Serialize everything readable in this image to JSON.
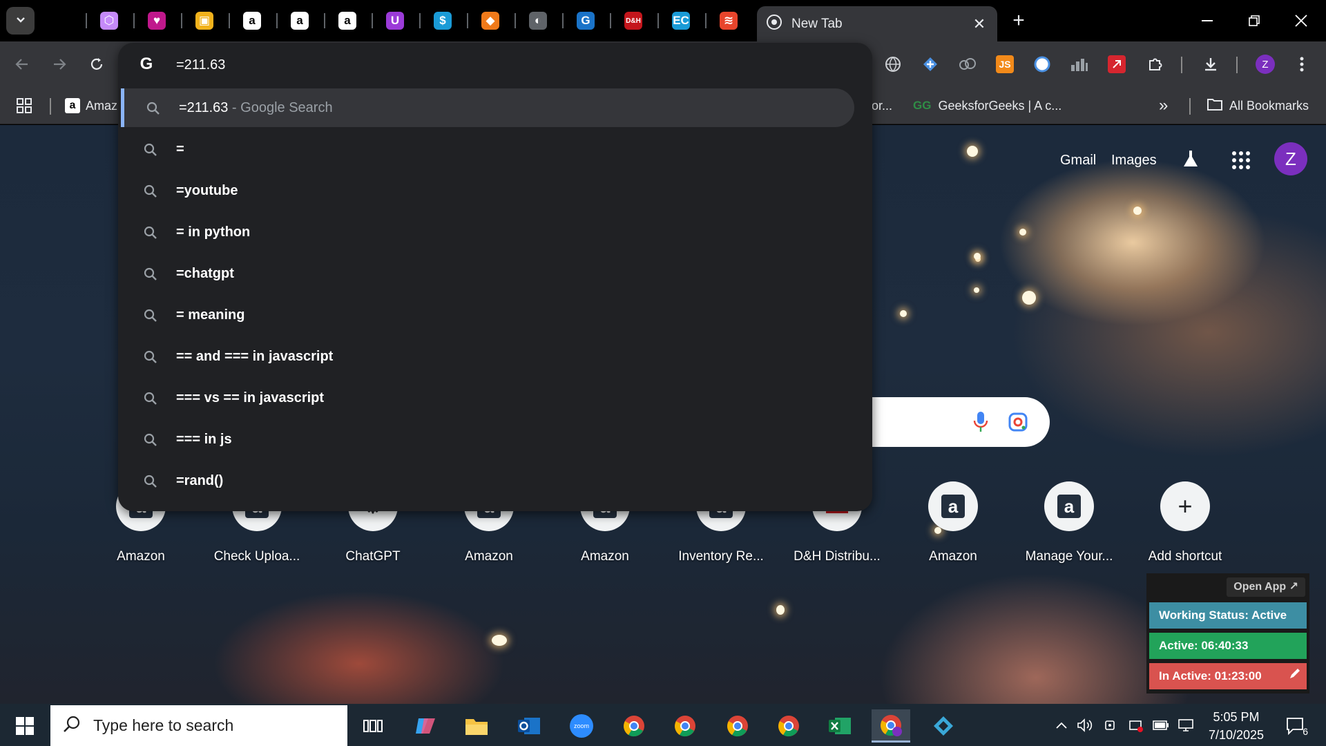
{
  "browser": {
    "active_tab": {
      "title": "New Tab"
    },
    "pinned_tabs": [
      {
        "icon": "cube-outline-icon",
        "color": "#c58af9",
        "glyph": "⬡"
      },
      {
        "icon": "purple-heart-app-icon",
        "color": "#c0188c",
        "glyph": "♥"
      },
      {
        "icon": "yellow-box-icon",
        "color": "#f2b21c",
        "glyph": "▣"
      },
      {
        "icon": "amazon-icon",
        "color": "#000000",
        "glyph": "a"
      },
      {
        "icon": "amazon-icon",
        "color": "#000000",
        "glyph": "a"
      },
      {
        "icon": "amazon-icon",
        "color": "#000000",
        "glyph": "a"
      },
      {
        "icon": "purple-u-icon",
        "color": "#9b3bd8",
        "glyph": "U"
      },
      {
        "icon": "dollar-icon",
        "color": "#1a9bd7",
        "glyph": "$"
      },
      {
        "icon": "orange-box-icon",
        "color": "#f07a1a",
        "glyph": "◆"
      },
      {
        "icon": "globe-grey-icon",
        "color": "#5f6368",
        "glyph": "◐"
      },
      {
        "icon": "blue-g-icon",
        "color": "#1a73c8",
        "glyph": "G"
      },
      {
        "icon": "dh-icon",
        "color": "#c4161c",
        "glyph": "D&H"
      },
      {
        "icon": "ec-icon",
        "color": "#1a9bd7",
        "glyph": "EC"
      },
      {
        "icon": "layers-red-icon",
        "color": "#e8452c",
        "glyph": "≋"
      }
    ]
  },
  "bookmarks": {
    "amazon_label": "Amaz",
    "partial_label": "or...",
    "geeks_label": "GeeksforGeeks | A c...",
    "more_label": "»",
    "all_label": "All Bookmarks"
  },
  "omnibox": {
    "value": "=211.63",
    "suggestions": [
      {
        "query": "=211.63",
        "suffix": " - Google Search"
      },
      {
        "query": "="
      },
      {
        "query": "=youtube"
      },
      {
        "query": "= in python"
      },
      {
        "query": "=chatgpt"
      },
      {
        "query": "= meaning"
      },
      {
        "query": "== and === in javascript"
      },
      {
        "query": "=== vs == in javascript"
      },
      {
        "query": "=== in js"
      },
      {
        "query": "=rand()"
      }
    ]
  },
  "ntp": {
    "gmail": "Gmail",
    "images": "Images",
    "avatar_letter": "Z",
    "shortcuts": [
      {
        "label": "Amazon",
        "glyph": "a"
      },
      {
        "label": "Check Uploa...",
        "glyph": "a"
      },
      {
        "label": "ChatGPT",
        "glyph": "⚙"
      },
      {
        "label": "Amazon",
        "glyph": "a"
      },
      {
        "label": "Amazon",
        "glyph": "a"
      },
      {
        "label": "Inventory Re...",
        "glyph": "a"
      },
      {
        "label": "D&H Distribu...",
        "glyph": "D&H"
      },
      {
        "label": "Amazon",
        "glyph": "a"
      },
      {
        "label": "Manage Your...",
        "glyph": "a"
      },
      {
        "label": "Add shortcut",
        "glyph": "+"
      }
    ]
  },
  "tracker": {
    "open_app": "Open App ↗",
    "status": "Working Status: Active",
    "active": "Active: 06:40:33",
    "inactive": "In Active: 01:23:00",
    "colors": {
      "status": "#3d8ea3",
      "active": "#22a35a",
      "inactive": "#d9534f"
    }
  },
  "taskbar": {
    "search_placeholder": "Type here to search",
    "time": "5:05 PM",
    "date": "7/10/2025",
    "notification_count": "6"
  }
}
